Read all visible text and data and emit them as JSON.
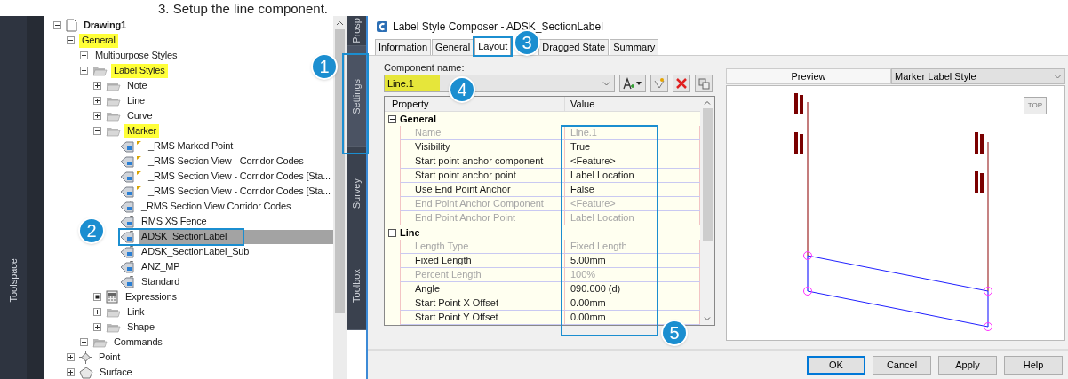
{
  "heading": "3. Setup the line component.",
  "toolspace": {
    "title": "Toolspace",
    "tabs": [
      {
        "label": "Prosp",
        "selected": false
      },
      {
        "label": "Settings",
        "selected": true
      },
      {
        "label": "Survey",
        "selected": false
      },
      {
        "label": "Toolbox",
        "selected": false
      }
    ]
  },
  "tree": [
    {
      "label": "Drawing1",
      "kind": "drawing",
      "expanded": true,
      "highlighted": false,
      "selected": false,
      "children": [
        {
          "label": "General",
          "kind": "style-group",
          "expanded": true,
          "highlighted": true,
          "selected": false,
          "children": [
            {
              "label": "Multipurpose Styles",
              "kind": "style-group",
              "expanded": false,
              "highlighted": false,
              "selected": false
            },
            {
              "label": "Label Styles",
              "kind": "folder",
              "expanded": true,
              "highlighted": true,
              "selected": false,
              "children": [
                {
                  "label": "Note",
                  "kind": "folder",
                  "expanded": false,
                  "highlighted": false,
                  "selected": false
                },
                {
                  "label": "Line",
                  "kind": "folder",
                  "expanded": false,
                  "highlighted": false,
                  "selected": false
                },
                {
                  "label": "Curve",
                  "kind": "folder",
                  "expanded": false,
                  "highlighted": false,
                  "selected": false
                },
                {
                  "label": "Marker",
                  "kind": "folder",
                  "expanded": true,
                  "highlighted": true,
                  "selected": false,
                  "children": [
                    {
                      "label": "_RMS Marked Point",
                      "kind": "label-style-flagged",
                      "highlighted": false,
                      "selected": false
                    },
                    {
                      "label": "_RMS Section View - Corridor Codes",
                      "kind": "label-style-flagged",
                      "highlighted": false,
                      "selected": false
                    },
                    {
                      "label": "_RMS Section View - Corridor Codes [Sta...",
                      "kind": "label-style-flagged",
                      "highlighted": false,
                      "selected": false
                    },
                    {
                      "label": "_RMS Section View - Corridor Codes [Sta...",
                      "kind": "label-style-flagged",
                      "highlighted": false,
                      "selected": false
                    },
                    {
                      "label": "_RMS Section View Corridor Codes",
                      "kind": "label-style",
                      "highlighted": false,
                      "selected": false
                    },
                    {
                      "label": " RMS XS Fence",
                      "kind": "label-style",
                      "highlighted": false,
                      "selected": false
                    },
                    {
                      "label": "ADSK_SectionLabel",
                      "kind": "label-style",
                      "highlighted": false,
                      "selected": true
                    },
                    {
                      "label": "ADSK_SectionLabel_Sub",
                      "kind": "label-style",
                      "highlighted": false,
                      "selected": false
                    },
                    {
                      "label": "ANZ_MP",
                      "kind": "label-style",
                      "highlighted": false,
                      "selected": false
                    },
                    {
                      "label": "Standard",
                      "kind": "label-style",
                      "highlighted": false,
                      "selected": false
                    }
                  ]
                },
                {
                  "label": "Expressions",
                  "kind": "expressions",
                  "highlighted": false,
                  "selected": false
                },
                {
                  "label": "Link",
                  "kind": "folder",
                  "expanded": false,
                  "highlighted": false,
                  "selected": false
                },
                {
                  "label": "Shape",
                  "kind": "folder",
                  "expanded": false,
                  "highlighted": false,
                  "selected": false
                }
              ]
            },
            {
              "label": "Commands",
              "kind": "folder",
              "expanded": false,
              "highlighted": false,
              "selected": false
            }
          ]
        },
        {
          "label": "Point",
          "kind": "point",
          "expanded": false,
          "highlighted": false,
          "selected": false
        },
        {
          "label": "Surface",
          "kind": "surface",
          "expanded": false,
          "highlighted": false,
          "selected": false
        }
      ]
    }
  ],
  "dialog": {
    "title": "Label Style Composer - ADSK_SectionLabel",
    "tabs": [
      {
        "label": "Information",
        "selected": false
      },
      {
        "label": "General",
        "selected": false
      },
      {
        "label": "Layout",
        "selected": true
      },
      {
        "label": "Dragged State",
        "selected": false
      },
      {
        "label": "Summary",
        "selected": false
      }
    ],
    "component_label": "Component name:",
    "component_value": "Line.1",
    "component_highlighted": true,
    "columns": [
      "Property",
      "Value"
    ],
    "groups": [
      {
        "title": "General",
        "expanded": true,
        "rows": [
          {
            "name": "Name",
            "value": "Line.1",
            "disabled": true
          },
          {
            "name": "Visibility",
            "value": "True",
            "disabled": false
          },
          {
            "name": "Start point anchor component",
            "value": "<Feature>",
            "disabled": false
          },
          {
            "name": "Start point anchor point",
            "value": "Label Location",
            "disabled": false
          },
          {
            "name": "Use End Point Anchor",
            "value": "False",
            "disabled": false
          },
          {
            "name": "End Point Anchor Component",
            "value": "<Feature>",
            "disabled": true
          },
          {
            "name": "End Point Anchor Point",
            "value": "Label Location",
            "disabled": true
          }
        ]
      },
      {
        "title": "Line",
        "expanded": true,
        "rows": [
          {
            "name": "Length Type",
            "value": "Fixed Length",
            "disabled": true
          },
          {
            "name": "Fixed Length",
            "value": "5.00mm",
            "disabled": false
          },
          {
            "name": "Percent Length",
            "value": "100%",
            "disabled": true
          },
          {
            "name": "Angle",
            "value": "090.000 (d)",
            "disabled": false
          },
          {
            "name": "Start Point X Offset",
            "value": "0.00mm",
            "disabled": false
          },
          {
            "name": "Start Point Y Offset",
            "value": "0.00mm",
            "disabled": false
          }
        ]
      }
    ],
    "preview": {
      "button": "Preview",
      "dropdown": "Marker Label Style",
      "view_button": "TOP"
    },
    "buttons": [
      {
        "label": "OK",
        "default": true
      },
      {
        "label": "Cancel",
        "default": false
      },
      {
        "label": "Apply",
        "default": false
      },
      {
        "label": "Help",
        "default": false
      }
    ]
  },
  "callouts": [
    "1",
    "2",
    "3",
    "4",
    "5"
  ]
}
